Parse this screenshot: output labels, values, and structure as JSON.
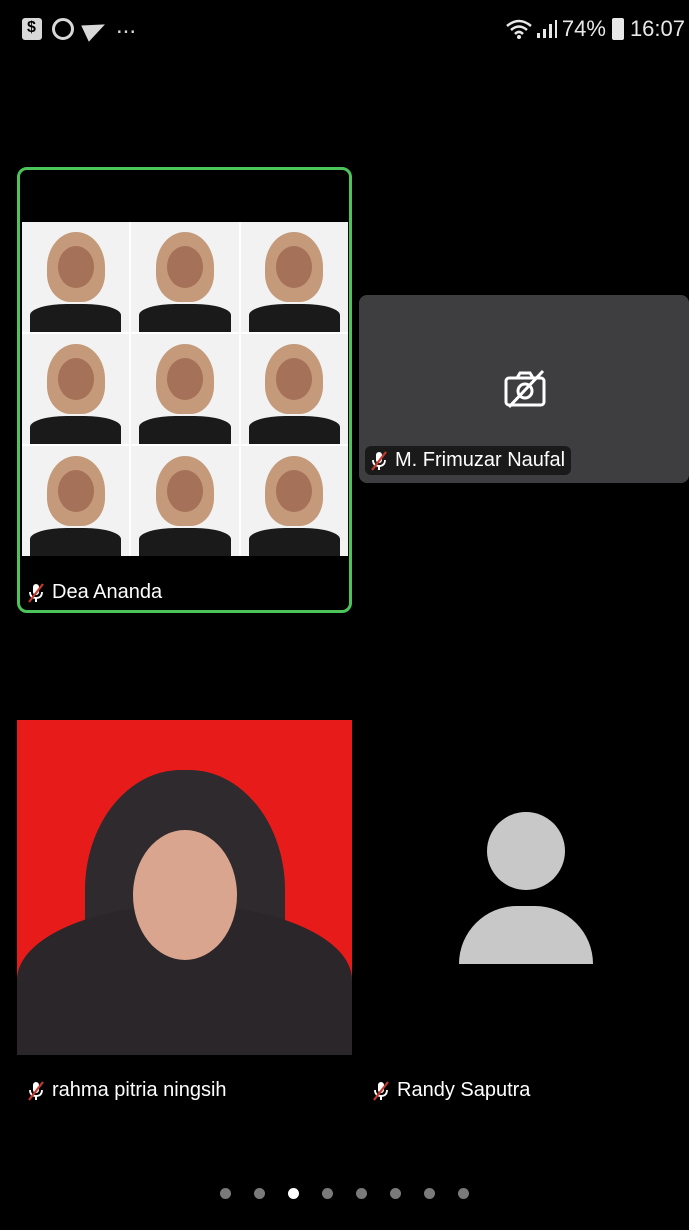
{
  "status_bar": {
    "more": "...",
    "battery_percent": "74%",
    "time": "16:07",
    "icons": [
      "shop-icon",
      "whatsapp-icon",
      "telegram-icon",
      "wifi-icon",
      "signal-icon",
      "battery-icon"
    ]
  },
  "participants": [
    {
      "name": "Dea Ananda",
      "muted": true,
      "video": "on",
      "active_speaker": true
    },
    {
      "name": "M. Frimuzar Naufal",
      "muted": true,
      "video": "off",
      "active_speaker": false
    },
    {
      "name": "rahma pitria ningsih",
      "muted": true,
      "video": "on",
      "active_speaker": false
    },
    {
      "name": "Randy Saputra",
      "muted": true,
      "video": "avatar",
      "active_speaker": false
    }
  ],
  "pagination": {
    "total_pages": 8,
    "current_page": 3
  },
  "colors": {
    "background": "#000000",
    "active_border": "#4cc45a",
    "camera_off_tile": "#3e3e40",
    "mute_icon": "#c43a2b",
    "avatar": "#c8c8c8"
  }
}
